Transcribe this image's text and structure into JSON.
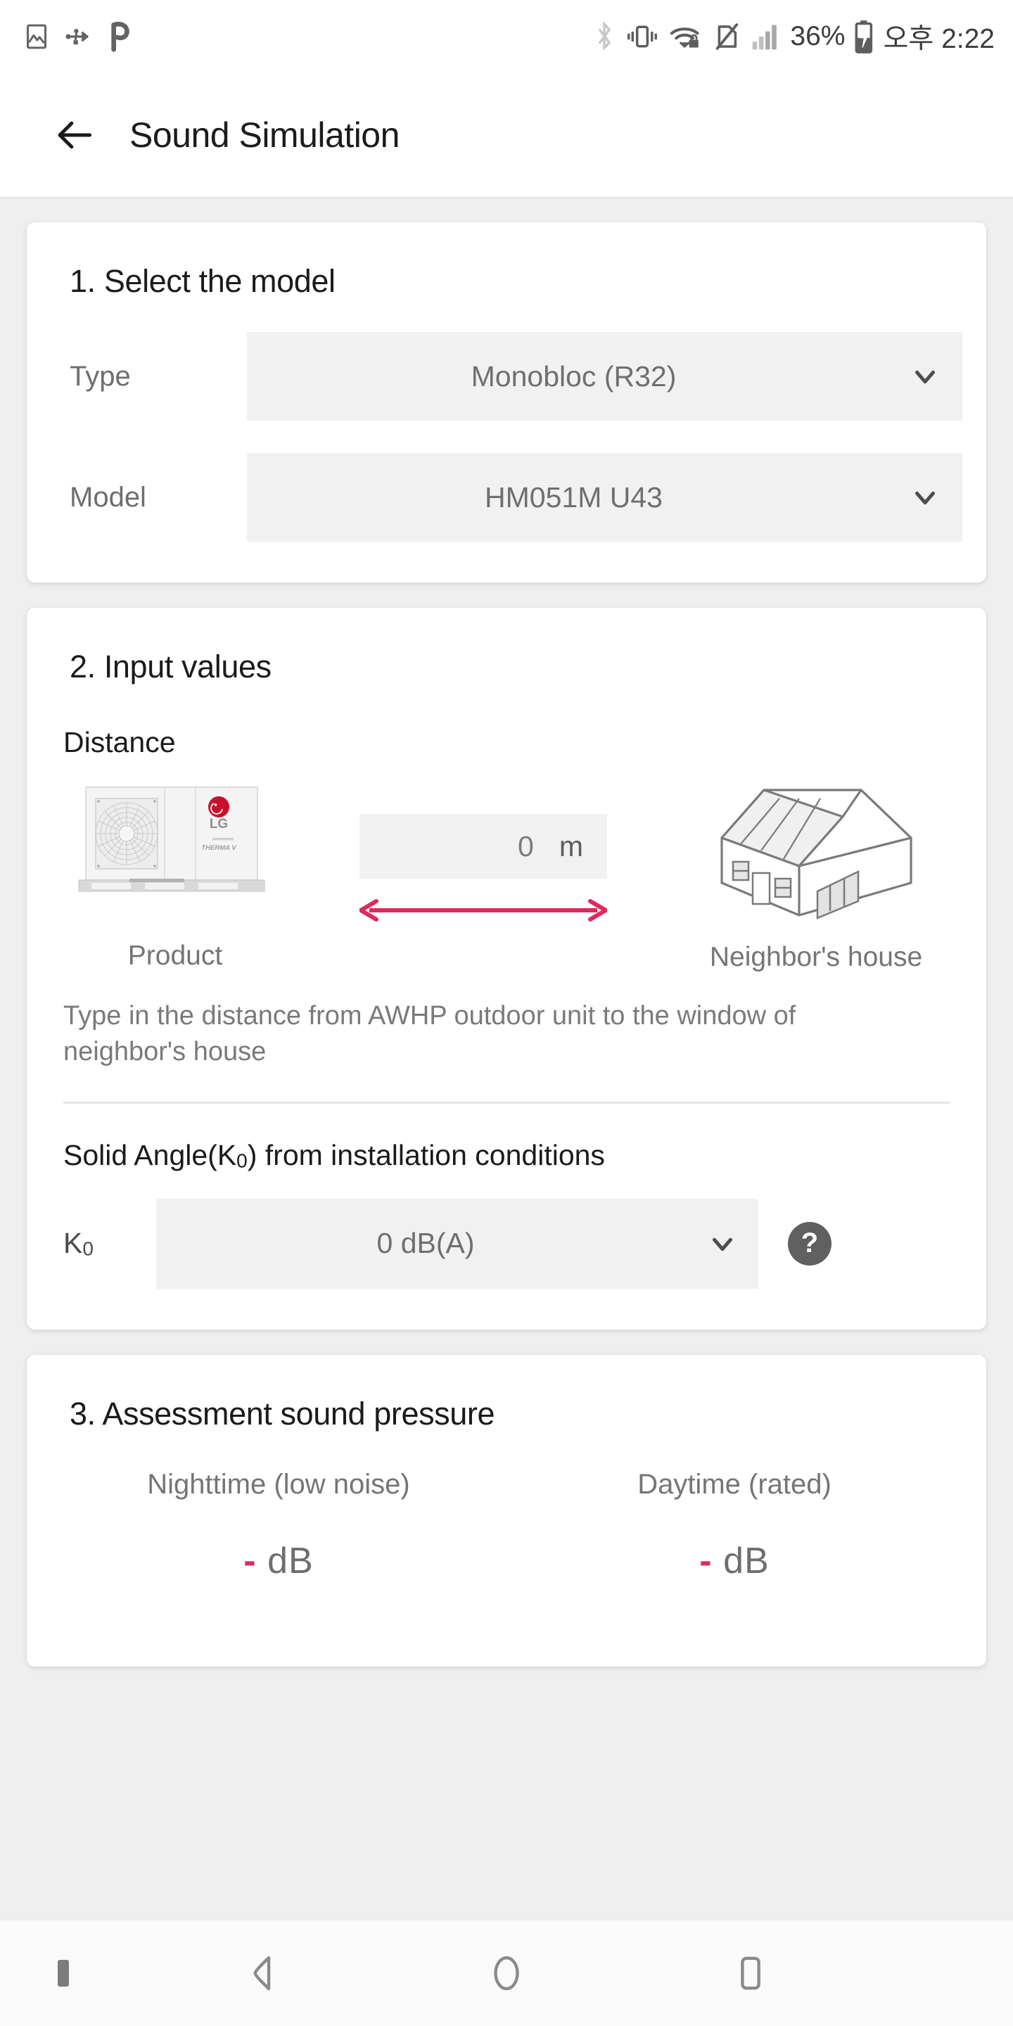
{
  "status_bar": {
    "icons_left": [
      "image-icon",
      "usb-icon",
      "pandora-p-icon"
    ],
    "icons_right": [
      "bluetooth-icon",
      "vibrate-icon",
      "wifi-lock-icon",
      "no-sim-icon",
      "signal-icon"
    ],
    "battery_percent": "36%",
    "battery_state": "charging",
    "time": "오후 2:22"
  },
  "appbar": {
    "back_icon": "arrow-left-icon",
    "title": "Sound Simulation"
  },
  "card_model": {
    "title": "1. Select the model",
    "rows": [
      {
        "label": "Type",
        "value": "Monobloc (R32)",
        "chevron": "chevron-down-icon"
      },
      {
        "label": "Model",
        "value": "HM051M U43",
        "chevron": "chevron-down-icon"
      }
    ]
  },
  "card_input": {
    "title": "2. Input values",
    "distance_heading": "Distance",
    "product_caption": "Product",
    "house_caption": "Neighbor's house",
    "distance_value": "0",
    "distance_unit": "m",
    "distance_placeholder": "0",
    "arrow_icon": "double-arrow-icon",
    "arrow_color": "#e0295e",
    "description": "Type in the distance from AWHP outdoor unit to the window of neighbor's house",
    "solid_angle_heading_before": "Solid Angle(K",
    "solid_angle_heading_sub": "0",
    "solid_angle_heading_after": ") from installation conditions",
    "k0_label_before": "K",
    "k0_label_sub": "0",
    "k0_value": "0 dB(A)",
    "k0_chevron": "chevron-down-icon",
    "help_icon": "question-mark-icon"
  },
  "card_result": {
    "title": "3. Assessment sound pressure",
    "columns": [
      {
        "label": "Nighttime (low noise)",
        "dash": "-",
        "unit": "dB"
      },
      {
        "label": "Daytime (rated)",
        "dash": "-",
        "unit": "dB"
      }
    ]
  },
  "nav_bar": {
    "items": [
      "nav-dot-indicator",
      "back-triangle-icon",
      "home-circle-icon",
      "recents-square-icon"
    ]
  }
}
